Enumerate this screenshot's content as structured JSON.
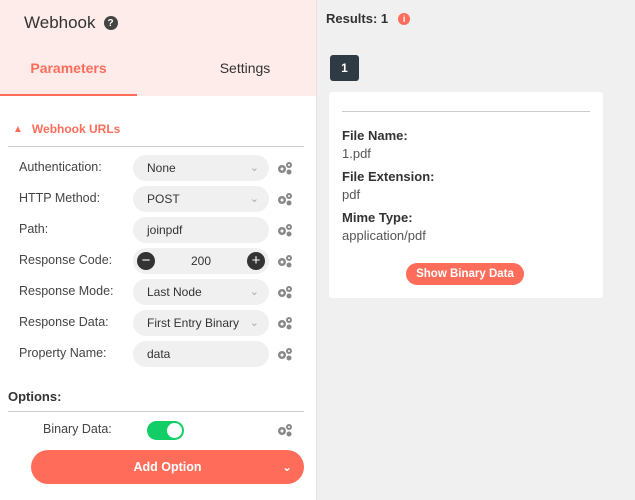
{
  "node": {
    "title": "Webhook",
    "help_icon": "question-circle-icon",
    "tabs": [
      {
        "label": "Parameters",
        "active": true
      },
      {
        "label": "Settings",
        "active": false
      }
    ]
  },
  "section": {
    "title": "Webhook URLs",
    "icon": "chevron-up-icon"
  },
  "params": [
    {
      "label": "Authentication:",
      "type": "dropdown",
      "value": "None"
    },
    {
      "label": "HTTP Method:",
      "type": "dropdown",
      "value": "POST"
    },
    {
      "label": "Path:",
      "type": "text",
      "value": "joinpdf"
    },
    {
      "label": "Response Code:",
      "type": "stepper",
      "value": "200"
    },
    {
      "label": "Response Mode:",
      "type": "dropdown",
      "value": "Last Node"
    },
    {
      "label": "Response Data:",
      "type": "dropdown",
      "value": "First Entry Binary"
    },
    {
      "label": "Property Name:",
      "type": "text",
      "value": "data"
    }
  ],
  "options": {
    "title": "Options:",
    "binary_data_label": "Binary Data:",
    "binary_data_enabled": true,
    "add_option_label": "Add Option"
  },
  "results": {
    "label": "Results: 1",
    "info_icon": "info-circle-icon",
    "page": "1",
    "file_name_label": "File Name:",
    "file_name": "1.pdf",
    "file_extension_label": "File Extension:",
    "file_extension": "pdf",
    "mime_type_label": "Mime Type:",
    "mime_type": "application/pdf",
    "show_binary_label": "Show Binary Data"
  },
  "colors": {
    "accent": "#ff6d5a",
    "toggle_on": "#13ce66",
    "header_bg": "#fdece9",
    "page_badge": "#2e3a44"
  }
}
